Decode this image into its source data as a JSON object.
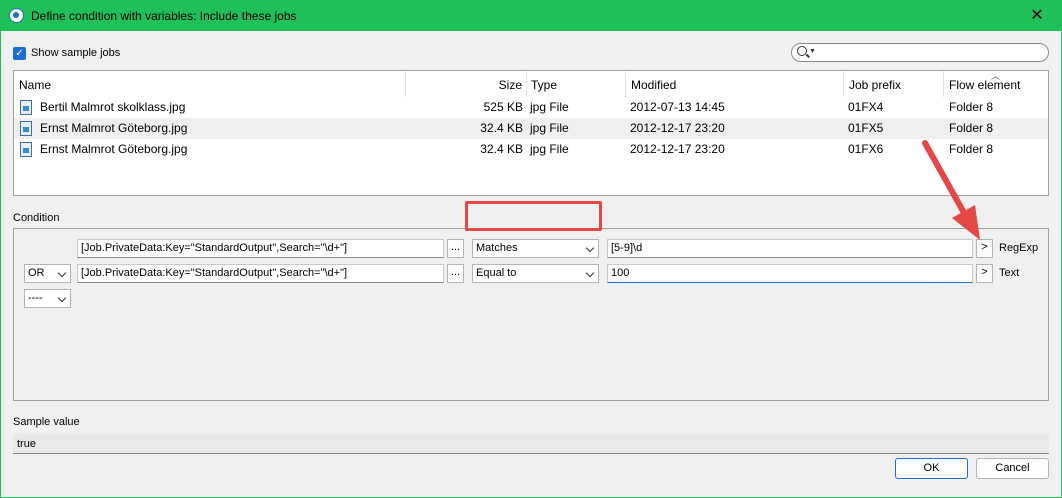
{
  "window": {
    "title": "Define condition with variables: Include these jobs",
    "close": "✕"
  },
  "toolbar": {
    "show_sample_jobs": "Show sample jobs",
    "checked_mark": "✓"
  },
  "jobs_table": {
    "columns": [
      "Name",
      "Size",
      "Type",
      "Modified",
      "Job prefix",
      "Flow element"
    ],
    "rows": [
      [
        "Bertil Malmrot skolklass.jpg",
        "525 KB",
        "jpg File",
        "2012-07-13 14:45",
        "01FX4",
        "Folder 8"
      ],
      [
        "Ernst Malmrot Göteborg.jpg",
        "32.4 KB",
        "jpg File",
        "2012-12-17 23:20",
        "01FX5",
        "Folder 8"
      ],
      [
        "Ernst Malmrot Göteborg.jpg",
        "32.4 KB",
        "jpg File",
        "2012-12-17 23:20",
        "01FX6",
        "Folder 8"
      ]
    ]
  },
  "condition": {
    "label": "Condition",
    "rows": [
      {
        "logic": "",
        "variable": "[Job.PrivateData:Key=\"StandardOutput\",Search=\"\\d+\"]",
        "operator": "Matches",
        "value": "[5-9]\\d",
        "value_type": "RegExp"
      },
      {
        "logic": "OR",
        "variable": "[Job.PrivateData:Key=\"StandardOutput\",Search=\"\\d+\"]",
        "operator": "Equal to",
        "value": "100",
        "value_type": "Text"
      }
    ],
    "empty_logic": "----",
    "dots_label": "...",
    "arrow_label": ">"
  },
  "sample": {
    "label": "Sample value",
    "value": "true"
  },
  "buttons": {
    "ok": "OK",
    "cancel": "Cancel"
  },
  "colors": {
    "accent": "#1a6fd0",
    "titlebar": "#1fbf5a",
    "annotation": "#e54646"
  }
}
